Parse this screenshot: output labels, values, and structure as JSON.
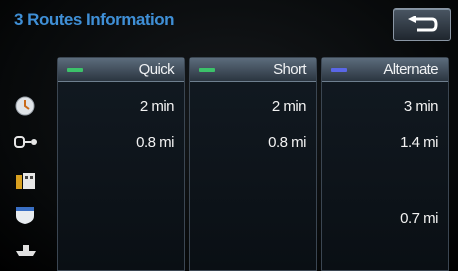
{
  "header": {
    "title": "3 Routes Information"
  },
  "toolbar": {
    "back_icon": "return-arrow-icon"
  },
  "row_icons": [
    "clock-icon",
    "toll-road-icon",
    "ferry-icon",
    "highway-icon",
    "route-ferry-icon"
  ],
  "routes": [
    {
      "name": "Quick",
      "time": "2 min",
      "distance": "0.8 mi",
      "third": "",
      "fourth": "",
      "color": "#3cc26a"
    },
    {
      "name": "Short",
      "time": "2 min",
      "distance": "0.8 mi",
      "third": "",
      "fourth": "",
      "color": "#3cc26a"
    },
    {
      "name": "Alternate",
      "time": "3 min",
      "distance": "1.4 mi",
      "third": "",
      "fourth": "0.7 mi",
      "color": "#5a67e6"
    }
  ]
}
